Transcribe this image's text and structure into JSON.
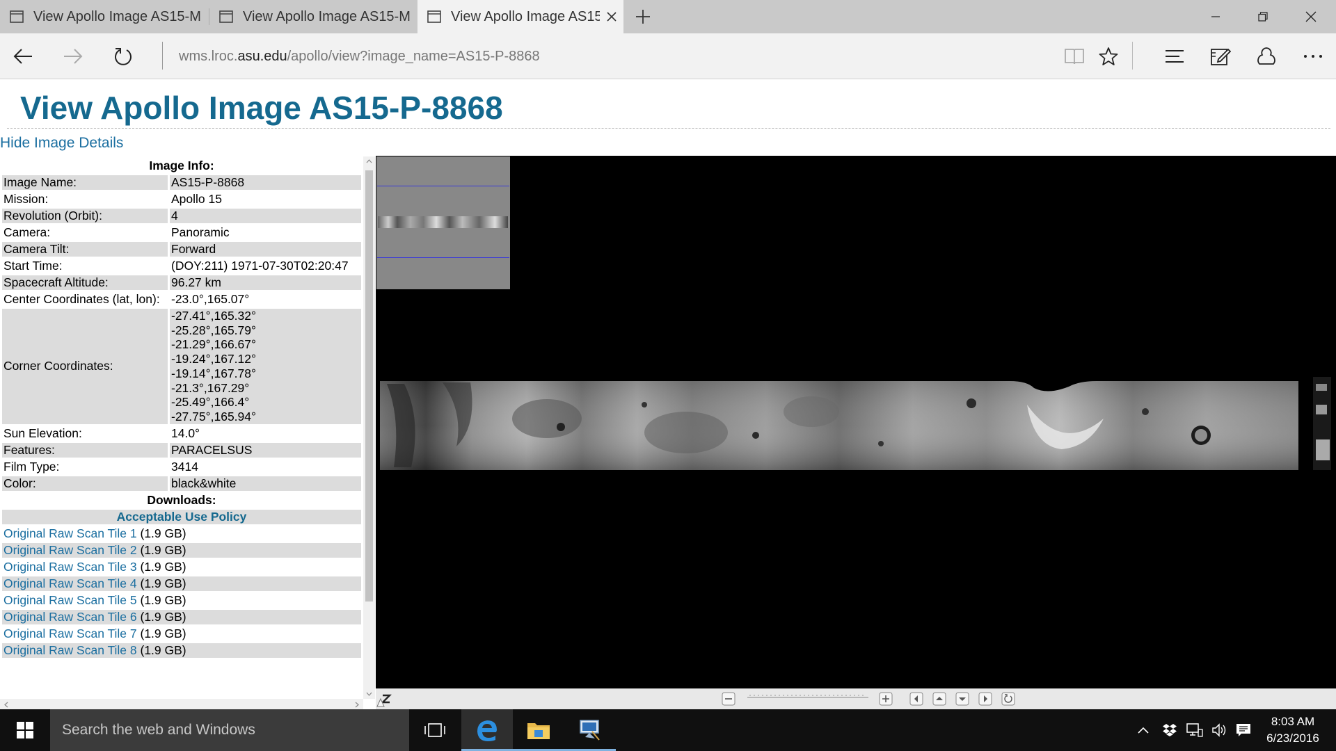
{
  "browser": {
    "tabs": [
      {
        "title": "View Apollo Image AS15-M",
        "active": false
      },
      {
        "title": "View Apollo Image AS15-M",
        "active": false
      },
      {
        "title": "View Apollo Image AS15",
        "active": true
      }
    ],
    "url": {
      "prefix": "wms.lroc.",
      "host": "asu.edu",
      "path": "/apollo/view?image_name=AS15-P-8868"
    }
  },
  "page": {
    "title": "View Apollo Image AS15-P-8868",
    "toggle_details": "Hide Image Details",
    "info_header": "Image Info:",
    "info": [
      {
        "label": "Image Name:",
        "value": "AS15-P-8868"
      },
      {
        "label": "Mission:",
        "value": "Apollo 15"
      },
      {
        "label": "Revolution (Orbit):",
        "value": "4"
      },
      {
        "label": "Camera:",
        "value": "Panoramic"
      },
      {
        "label": "Camera Tilt:",
        "value": "Forward"
      },
      {
        "label": "Start Time:",
        "value": "(DOY:211) 1971-07-30T02:20:47"
      },
      {
        "label": "Spacecraft Altitude:",
        "value": "96.27 km"
      },
      {
        "label": "Center Coordinates (lat, lon):",
        "value": "-23.0°,165.07°"
      }
    ],
    "corner": {
      "label": "Corner Coordinates:",
      "values": [
        "-27.41°,165.32°",
        "-25.28°,165.79°",
        "-21.29°,166.67°",
        "-19.24°,167.12°",
        "-19.14°,167.78°",
        "-21.3°,167.29°",
        "-25.49°,166.4°",
        "-27.75°,165.94°"
      ]
    },
    "info2": [
      {
        "label": "Sun Elevation:",
        "value": "14.0°"
      },
      {
        "label": "Features:",
        "value": "PARACELSUS"
      },
      {
        "label": "Film Type:",
        "value": "3414"
      },
      {
        "label": "Color:",
        "value": "black&white"
      }
    ],
    "downloads_header": "Downloads:",
    "policy_link": "Acceptable Use Policy",
    "downloads": [
      {
        "label": "Original Raw Scan Tile 1",
        "size": " (1.9 GB)"
      },
      {
        "label": "Original Raw Scan Tile 2",
        "size": " (1.9 GB)"
      },
      {
        "label": "Original Raw Scan Tile 3",
        "size": " (1.9 GB)"
      },
      {
        "label": "Original Raw Scan Tile 4",
        "size": " (1.9 GB)"
      },
      {
        "label": "Original Raw Scan Tile 5",
        "size": " (1.9 GB)"
      },
      {
        "label": "Original Raw Scan Tile 6",
        "size": " (1.9 GB)"
      },
      {
        "label": "Original Raw Scan Tile 7",
        "size": " (1.9 GB)"
      },
      {
        "label": "Original Raw Scan Tile 8",
        "size": " (1.9 GB)"
      }
    ]
  },
  "viewer": {
    "zoom_level": 0.02,
    "icons": [
      "zoom-logo-icon",
      "zoom-out-icon",
      "zoom-in-icon",
      "pan-left-icon",
      "pan-up-icon",
      "pan-down-icon",
      "pan-right-icon",
      "reset-icon"
    ]
  },
  "taskbar": {
    "search_placeholder": "Search the web and Windows",
    "time": "8:03 AM",
    "date": "6/23/2016"
  },
  "colors": {
    "title": "#15698f",
    "link": "#1a6ea0",
    "row_shade": "#dcdcdc",
    "tab_bar": "#c9c9c9",
    "active_tab": "#f2f2f2",
    "taskbar": "#101010"
  }
}
